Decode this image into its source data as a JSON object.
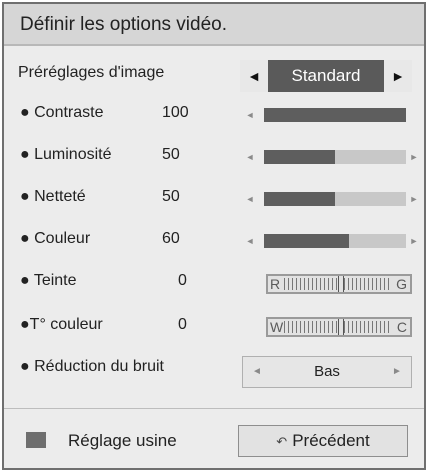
{
  "header": {
    "title": "Définir les options vidéo."
  },
  "preset": {
    "label": "Préréglages d'image",
    "value": "Standard",
    "left_arrow": "◄",
    "right_arrow": "►"
  },
  "rows": {
    "contrast": {
      "label": "● Contraste",
      "value": "100",
      "level": 1.0,
      "has_right_arrow": false
    },
    "brightness": {
      "label": "● Luminosité",
      "value": "50",
      "level": 0.5,
      "has_right_arrow": true
    },
    "sharpness": {
      "label": "● Netteté",
      "value": "50",
      "level": 0.5,
      "has_right_arrow": true
    },
    "color": {
      "label": "● Couleur",
      "value": "60",
      "level": 0.6,
      "has_right_arrow": true
    },
    "tint": {
      "label": "● Teinte",
      "value": "0",
      "left_letter": "R",
      "right_letter": "G"
    },
    "temp": {
      "label": "●T° couleur",
      "value": "0",
      "left_letter": "W",
      "right_letter": "C"
    },
    "noise": {
      "label": "● Réduction du bruit",
      "value": "Bas",
      "left_arrow": "◄",
      "right_arrow": "►"
    }
  },
  "slider_arrows": {
    "left": "◄",
    "right": "►"
  },
  "footer": {
    "reset_label": "Réglage usine",
    "back_label": "Précédent",
    "back_icon": "back-arrow-icon"
  },
  "colors": {
    "panel_bg": "#ececec",
    "header_bg": "#d6d6d6",
    "fill": "#5e5e5e",
    "track": "#c8c8c8",
    "preset_bg": "#5a5a5a"
  }
}
